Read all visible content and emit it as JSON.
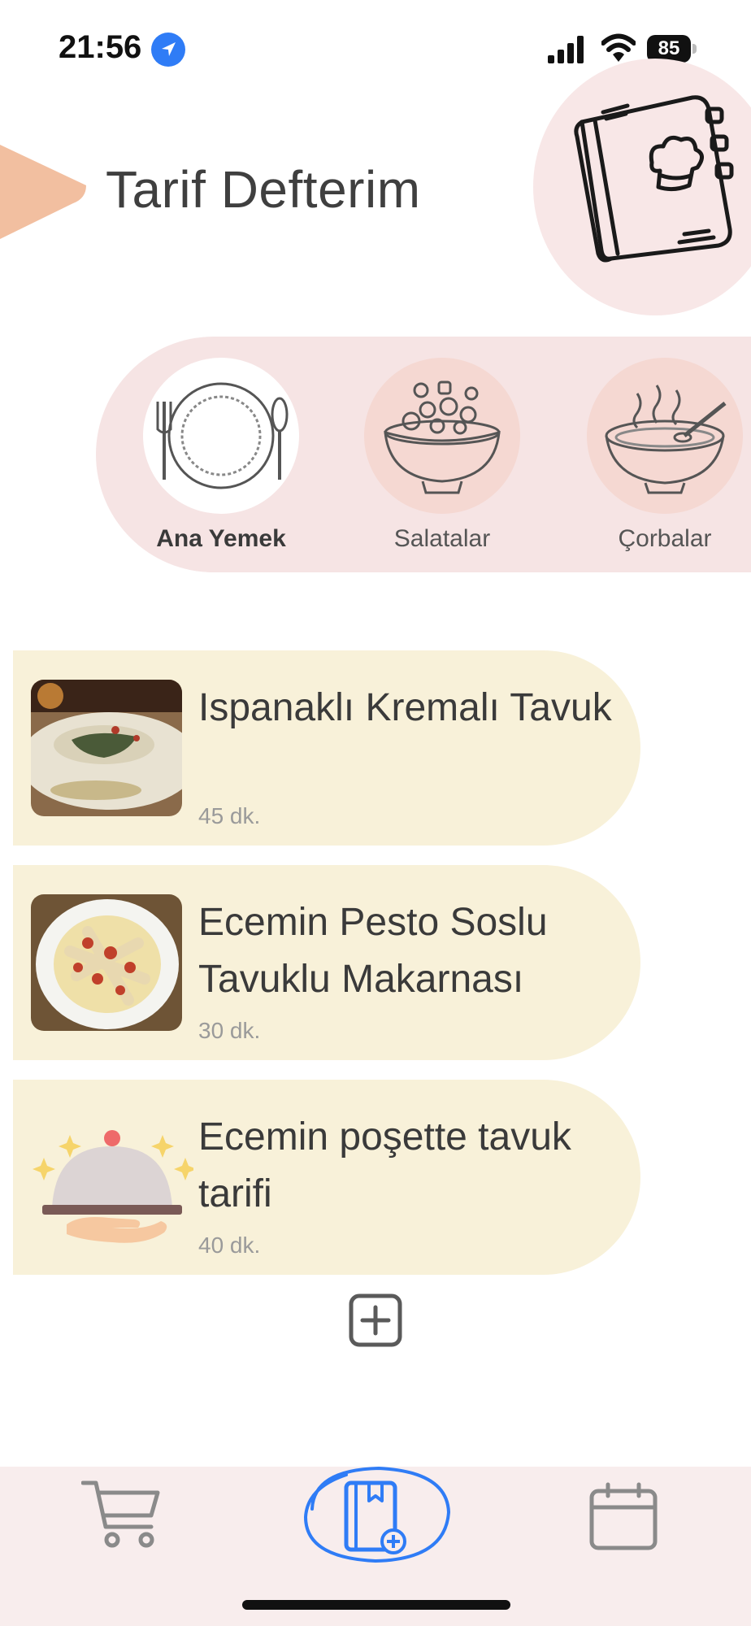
{
  "status_bar": {
    "time": "21:56",
    "battery": "85"
  },
  "header": {
    "title": "Tarif Defterim"
  },
  "categories": [
    {
      "label": "Ana Yemek",
      "active": true,
      "icon": "plate-icon"
    },
    {
      "label": "Salatalar",
      "active": false,
      "icon": "salad-bowl-icon"
    },
    {
      "label": "Çorbalar",
      "active": false,
      "icon": "soup-bowl-icon"
    }
  ],
  "recipes": [
    {
      "name": "Ispanaklı Kremalı Tavuk",
      "time": "45 dk."
    },
    {
      "name": "Ecemin Pesto Soslu Tavuklu Makarnası",
      "time": "30 dk."
    },
    {
      "name": "Ecemin poşette tavuk tarifi",
      "time": "40 dk."
    }
  ],
  "tabbar": {
    "items": [
      {
        "icon": "cart-icon",
        "active": false
      },
      {
        "icon": "recipe-book-add-icon",
        "active": true
      },
      {
        "icon": "calendar-icon",
        "active": false
      }
    ]
  },
  "colors": {
    "accent_blue": "#2f7cf6",
    "card_bg": "#f8f1d9",
    "category_panel": "#f6e4e4",
    "header_arrow": "#f2bfa0"
  }
}
